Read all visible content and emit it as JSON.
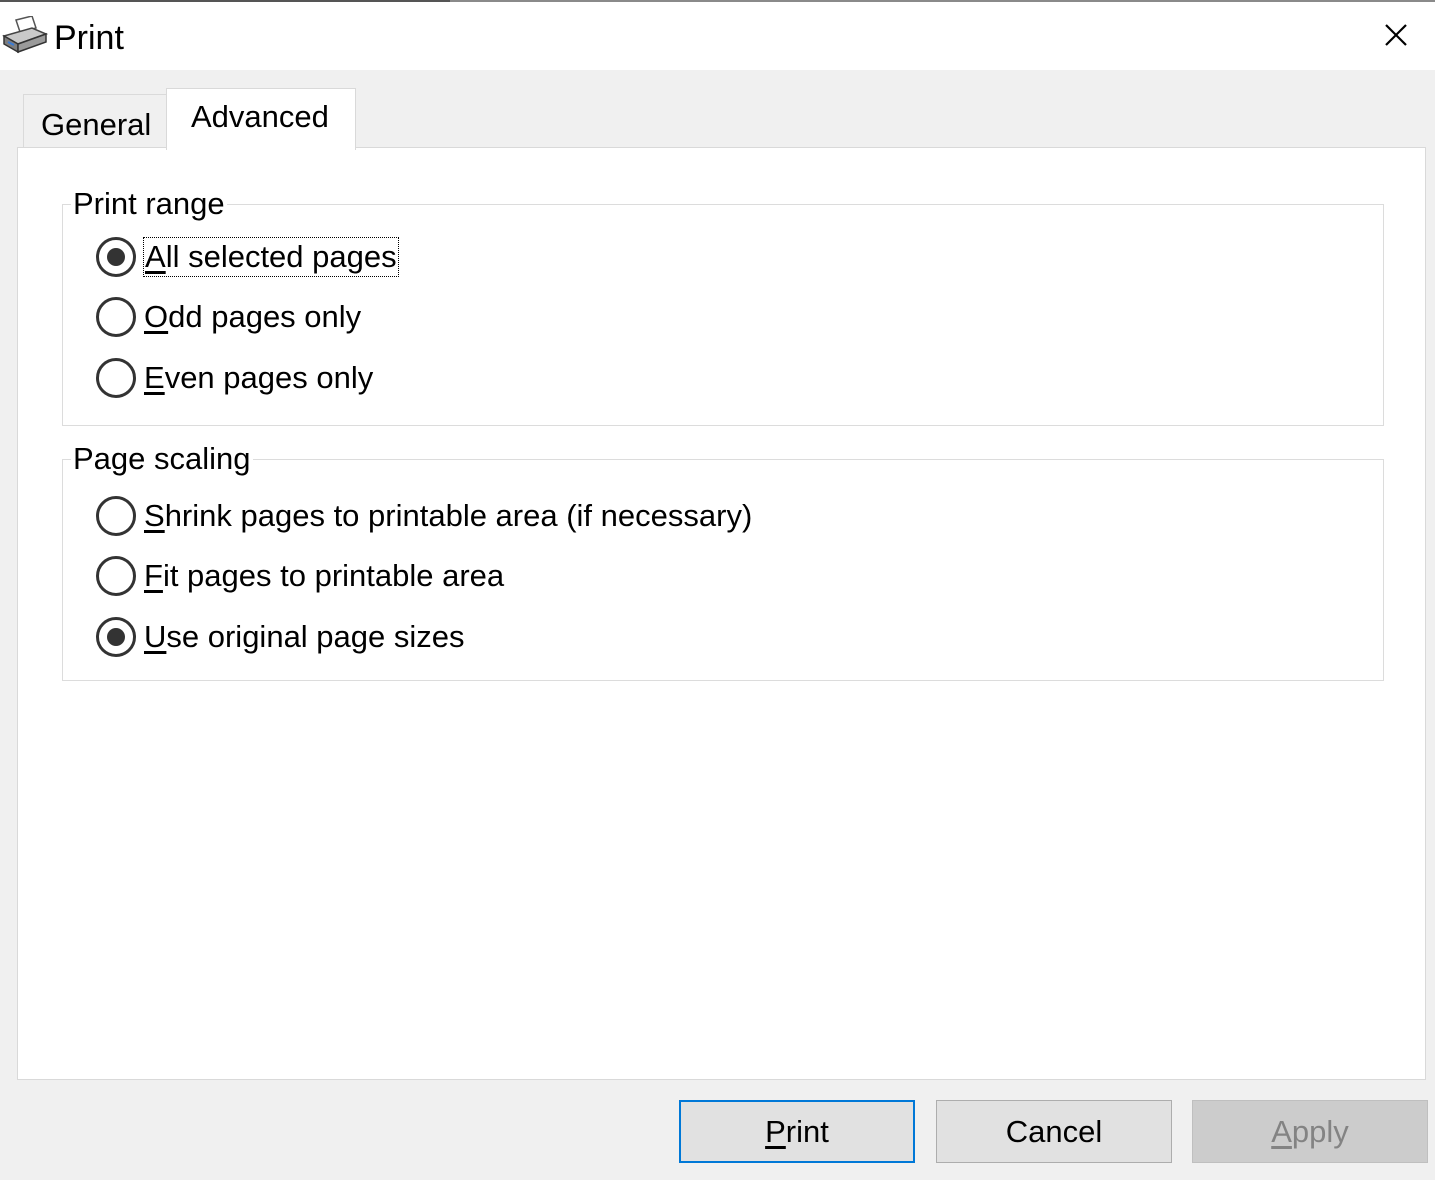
{
  "window": {
    "title": "Print",
    "icon": "printer-icon"
  },
  "tabs": [
    {
      "label": "General",
      "active": false
    },
    {
      "label": "Advanced",
      "active": true
    }
  ],
  "print_range": {
    "legend": "Print range",
    "options": [
      {
        "mnemonic": "A",
        "rest": "ll selected pages",
        "checked": true,
        "focused": true
      },
      {
        "mnemonic": "O",
        "rest": "dd pages only",
        "checked": false,
        "focused": false
      },
      {
        "mnemonic": "E",
        "rest": "ven pages only",
        "checked": false,
        "focused": false
      }
    ]
  },
  "page_scaling": {
    "legend": "Page scaling",
    "options": [
      {
        "mnemonic": "S",
        "rest": "hrink pages to printable area (if necessary)",
        "checked": false,
        "focused": false
      },
      {
        "mnemonic": "F",
        "rest": "it pages to printable area",
        "checked": false,
        "focused": false
      },
      {
        "mnemonic": "U",
        "rest": "se original page sizes",
        "checked": true,
        "focused": false
      }
    ]
  },
  "buttons": {
    "print": {
      "mnemonic": "P",
      "rest": "rint",
      "enabled": true,
      "default": true
    },
    "cancel": {
      "label": "Cancel",
      "enabled": true
    },
    "apply": {
      "mnemonic": "A",
      "rest": "pply",
      "enabled": false
    }
  },
  "colors": {
    "focus_border": "#0078d7",
    "disabled_text": "#838383",
    "radio": "#333333"
  }
}
